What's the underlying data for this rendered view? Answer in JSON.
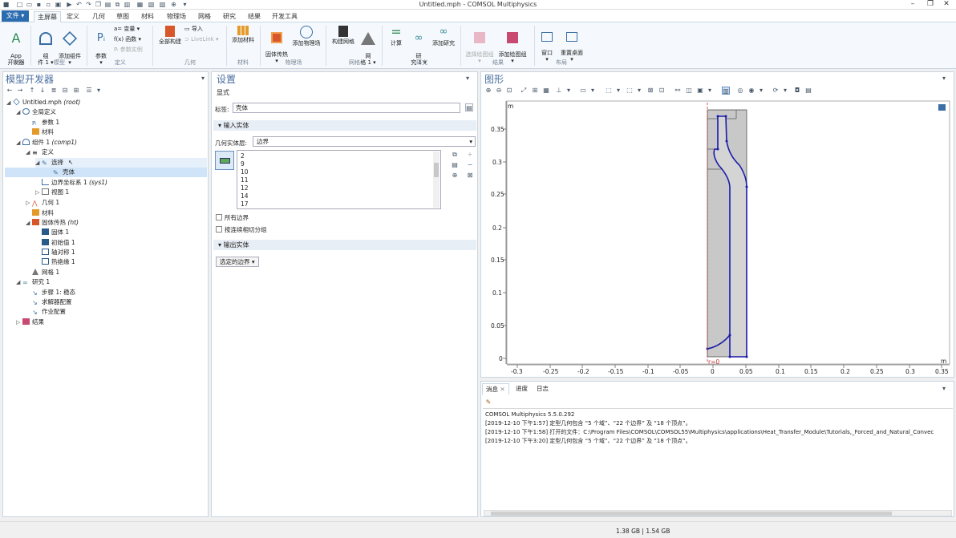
{
  "window": {
    "title": "Untitled.mph - COMSOL Multiphysics"
  },
  "ribbon_tabs": [
    "文件 ▾",
    "主屏幕",
    "定义",
    "几何",
    "草图",
    "材料",
    "物理场",
    "网格",
    "研究",
    "结果",
    "开发工具"
  ],
  "ribbon": {
    "app_builder": "App\n开发器",
    "components": "组\n件 1 ▾",
    "add_component": "添加组件\n▾",
    "parameters": "参数\n▾",
    "variables": "a= 变量 ▾",
    "functions": "f(x) 函数 ▾",
    "param_case": "Pᵢ 参数实例",
    "build_all": "全部构建",
    "import": "导入",
    "livelink": "LiveLink ▾",
    "add_material": "添加材料",
    "solid_heat": "固体传热\n▾",
    "add_physics": "添加物理场",
    "build_mesh": "构建网格",
    "mesh": "网\n格 1 ▾",
    "compute": "计算",
    "study": "研\n究 1 ▾",
    "add_study": "添加研究",
    "select_plot": "选择绘图组\n▾",
    "add_plot": "添加绘图组\n▾",
    "windows": "窗口\n▾",
    "reset_desktop": "重置桌面\n▾",
    "groups": [
      "App",
      "模型",
      "定义",
      "几何",
      "材料",
      "物理场",
      "网格",
      "研究",
      "结果",
      "布局"
    ]
  },
  "model_builder": {
    "title": "模型开发器",
    "tree": [
      {
        "label": "Untitled.mph",
        "tag": "(root)"
      },
      {
        "label": "全局定义",
        "tag": ""
      },
      {
        "label": "参数 1",
        "tag": ""
      },
      {
        "label": "材料",
        "tag": ""
      },
      {
        "label": "组件 1",
        "tag": "(comp1)"
      },
      {
        "label": "定义",
        "tag": ""
      },
      {
        "label": "选择",
        "tag": ""
      },
      {
        "label": "壳体",
        "tag": ""
      },
      {
        "label": "边界坐标系 1",
        "tag": "(sys1)"
      },
      {
        "label": "视图 1",
        "tag": ""
      },
      {
        "label": "几何 1",
        "tag": ""
      },
      {
        "label": "材料",
        "tag": ""
      },
      {
        "label": "固体传热",
        "tag": "(ht)"
      },
      {
        "label": "固体 1",
        "tag": ""
      },
      {
        "label": "初始值 1",
        "tag": ""
      },
      {
        "label": "轴对称 1",
        "tag": ""
      },
      {
        "label": "热绝缘 1",
        "tag": ""
      },
      {
        "label": "网格 1",
        "tag": ""
      },
      {
        "label": "研究 1",
        "tag": ""
      },
      {
        "label": "步骤 1: 稳态",
        "tag": ""
      },
      {
        "label": "求解器配置",
        "tag": ""
      },
      {
        "label": "作业配置",
        "tag": ""
      },
      {
        "label": "结果",
        "tag": ""
      }
    ]
  },
  "settings": {
    "title": "设置",
    "subtitle": "显式",
    "label_caption": "标签:",
    "label_value": "壳体",
    "input_section": "输入实体",
    "geom_level_caption": "几何实体层:",
    "geom_level_value": "边界",
    "list_items": [
      "2",
      "9",
      "10",
      "11",
      "12",
      "14",
      "17"
    ],
    "all_boundaries": "所有边界",
    "group_by_continuous": "按连续相切分组",
    "output_section": "输出实体",
    "output_select": "选定的边界 ▾"
  },
  "graphics": {
    "title": "图形",
    "unit": "m",
    "origin_label": "r=0",
    "y_ticks": [
      "0.35",
      "0.3",
      "0.25",
      "0.2",
      "0.15",
      "0.1",
      "0.05",
      "0"
    ],
    "x_ticks": [
      "-0.3",
      "-0.25",
      "-0.2",
      "-0.15",
      "-0.1",
      "-0.05",
      "0",
      "0.05",
      "0.1",
      "0.15",
      "0.2",
      "0.25",
      "0.3",
      "0.35"
    ]
  },
  "messages": {
    "tabs": [
      "消息",
      "进度",
      "日志"
    ],
    "lines": [
      "COMSOL Multiphysics 5.5.0.292",
      "[2019-12-10 下午1:57] 定型几何包含 “5 个域”、“22 个边界” 及 “18 个顶点”。",
      "[2019-12-10 下午1:58] 打开的文件：C:\\Program Files\\COMSOL\\COMSOL55\\Multiphysics\\applications\\Heat_Transfer_Module\\Tutorials,_Forced_and_Natural_Convec",
      "[2019-12-10 下午3:20] 定型几何包含 “5 个域”、“22 个边界” 及 “18 个顶点”。"
    ]
  },
  "status": {
    "memory": "1.38 GB | 1.54 GB"
  },
  "colors": {
    "accent": "#2b6cb0",
    "title_blue": "#4a6fa0",
    "geometry_fill": "#c8c8c8",
    "selection_blue": "#1a1aaa"
  }
}
